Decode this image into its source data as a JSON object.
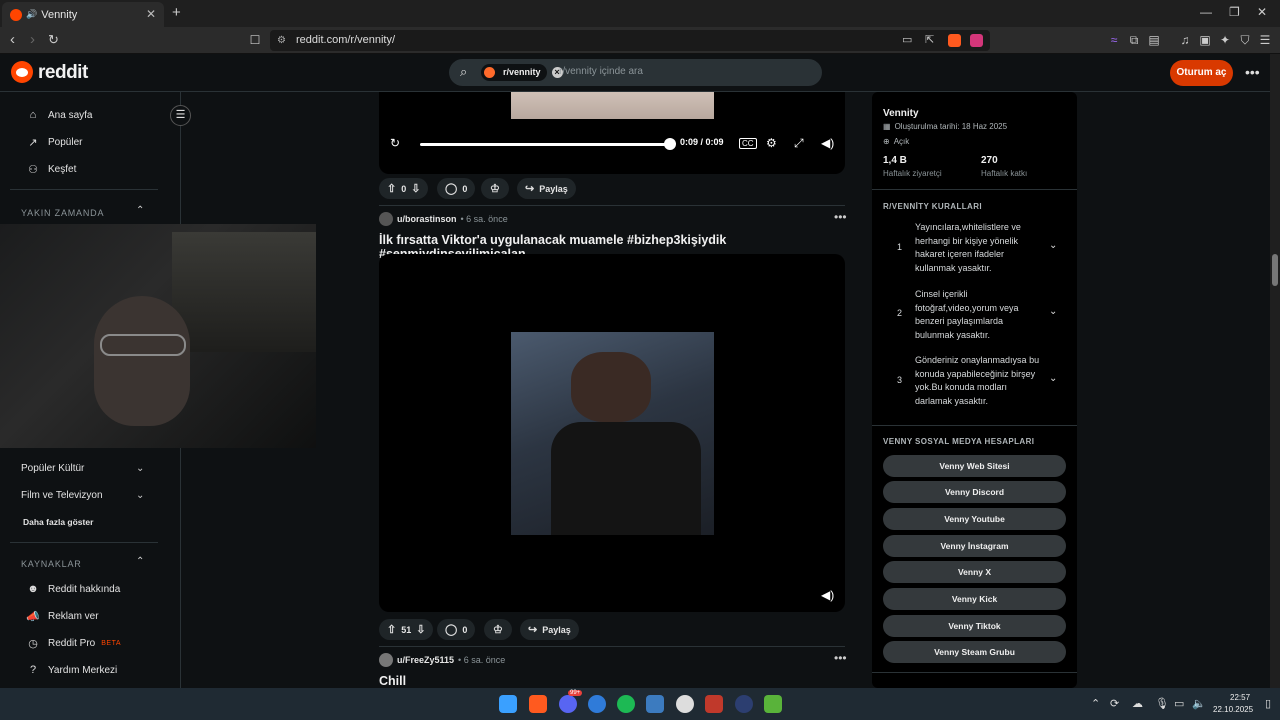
{
  "browser": {
    "tab_title": "Vennity",
    "url": "reddit.com/r/vennity/",
    "new_tab": "+",
    "tab_close": "✕"
  },
  "header": {
    "logo": "reddit",
    "search_chip": "r/vennity",
    "search_placeholder": "r/vennity içinde ara",
    "login_label": "Oturum aç",
    "more": "•••"
  },
  "sidebar": {
    "items": [
      {
        "label": "Ana sayfa",
        "icon": "home-icon"
      },
      {
        "label": "Popüler",
        "icon": "popular-icon"
      },
      {
        "label": "Keşfet",
        "icon": "explore-icon"
      }
    ],
    "recent_header": "YAKIN ZAMANDA",
    "topics": [
      {
        "label": "Popüler Kültür"
      },
      {
        "label": "Film ve Televizyon"
      }
    ],
    "show_more": "Daha fazla göster",
    "resources_header": "KAYNAKLAR",
    "resources": [
      {
        "label": "Reddit hakkında"
      },
      {
        "label": "Reklam ver"
      },
      {
        "label": "Reddit Pro",
        "badge": "BETA"
      },
      {
        "label": "Yardım Merkezi"
      }
    ]
  },
  "feed": {
    "first_post": {
      "time": "0:09 / 0:09",
      "progress": 1.0,
      "votes": "0",
      "comments": "0",
      "share": "Paylaş"
    },
    "second_post": {
      "author": "u/borastinson",
      "age": "• 6 sa. önce",
      "title": "İlk fırsatta Viktor'a uygulanacak muamele #bizhep3kişiydik #senmiydinsevilimiçalan",
      "votes": "51",
      "comments": "0",
      "share": "Paylaş"
    },
    "third_post": {
      "author": "u/FreeZy5115",
      "age": "• 6 sa. önce",
      "title": "Chill"
    }
  },
  "community": {
    "name": "Vennity",
    "created": "Oluşturulma tarihi: 18 Haz 2025",
    "visibility": "Açık",
    "visitors_value": "1,4 B",
    "visitors_label": "Haftalık ziyaretçi",
    "contrib_value": "270",
    "contrib_label": "Haftalık katkı",
    "rules_header": "R/VENNİTY KURALLARI",
    "rules": [
      {
        "n": "1",
        "text": "Yayıncılara,whitelistlere ve herhangi bir kişiye yönelik hakaret içeren ifadeler kullanmak yasaktır."
      },
      {
        "n": "2",
        "text": "Cinsel içerikli fotoğraf,video,yorum veya benzeri paylaşımlarda bulunmak yasaktır."
      },
      {
        "n": "3",
        "text": "Gönderiniz onaylanmadıysa bu konuda yapabileceğiniz birşey yok.Bu konuda modları darlamak yasaktır."
      }
    ],
    "social_header": "VENNY SOSYAL MEDYA HESAPLARI",
    "social_buttons": [
      "Venny Web Sitesi",
      "Venny Discord",
      "Venny Youtube",
      "Venny İnstagram",
      "Venny X",
      "Venny Kick",
      "Venny Tiktok",
      "Venny Steam Grubu"
    ]
  },
  "taskbar": {
    "time": "22:57",
    "date": "22.10.2025",
    "notif_badge": "99+"
  },
  "colors": {
    "accent": "#d93900",
    "reddit_orange": "#ff4500",
    "background": "#0e1113"
  }
}
